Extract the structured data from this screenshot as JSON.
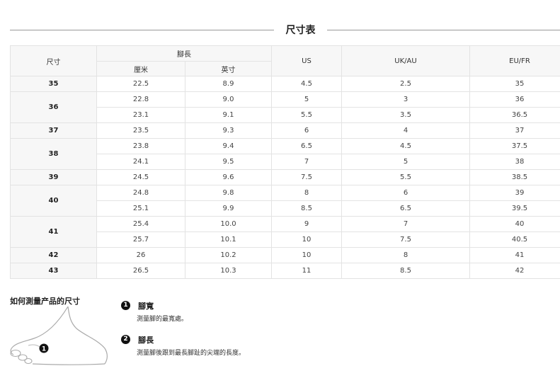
{
  "title": "尺寸表",
  "table": {
    "header_size": "尺寸",
    "header_foot_length": "腳長",
    "header_cm": "厘米",
    "header_inch": "英寸",
    "header_us": "US",
    "header_ukau": "UK/AU",
    "header_eufr": "EU/FR",
    "groups": [
      {
        "size": "35",
        "rows": [
          [
            "22.5",
            "8.9",
            "4.5",
            "2.5",
            "35"
          ]
        ]
      },
      {
        "size": "36",
        "rows": [
          [
            "22.8",
            "9.0",
            "5",
            "3",
            "36"
          ],
          [
            "23.1",
            "9.1",
            "5.5",
            "3.5",
            "36.5"
          ]
        ]
      },
      {
        "size": "37",
        "rows": [
          [
            "23.5",
            "9.3",
            "6",
            "4",
            "37"
          ]
        ]
      },
      {
        "size": "38",
        "rows": [
          [
            "23.8",
            "9.4",
            "6.5",
            "4.5",
            "37.5"
          ],
          [
            "24.1",
            "9.5",
            "7",
            "5",
            "38"
          ]
        ]
      },
      {
        "size": "39",
        "rows": [
          [
            "24.5",
            "9.6",
            "7.5",
            "5.5",
            "38.5"
          ]
        ]
      },
      {
        "size": "40",
        "rows": [
          [
            "24.8",
            "9.8",
            "8",
            "6",
            "39"
          ],
          [
            "25.1",
            "9.9",
            "8.5",
            "6.5",
            "39.5"
          ]
        ]
      },
      {
        "size": "41",
        "rows": [
          [
            "25.4",
            "10.0",
            "9",
            "7",
            "40"
          ],
          [
            "25.7",
            "10.1",
            "10",
            "7.5",
            "40.5"
          ]
        ]
      },
      {
        "size": "42",
        "rows": [
          [
            "26",
            "10.2",
            "10",
            "8",
            "41"
          ]
        ]
      },
      {
        "size": "43",
        "rows": [
          [
            "26.5",
            "10.3",
            "11",
            "8.5",
            "42"
          ]
        ]
      }
    ]
  },
  "howto": {
    "title": "如何測量产品的尺寸",
    "steps": [
      {
        "num": "1",
        "label": "腳寬",
        "desc": "測量腳的最寬處。"
      },
      {
        "num": "2",
        "label": "腳長",
        "desc": "測量腳後跟到最長腳趾的尖端的長度。"
      }
    ],
    "diagram_marker": "1"
  }
}
